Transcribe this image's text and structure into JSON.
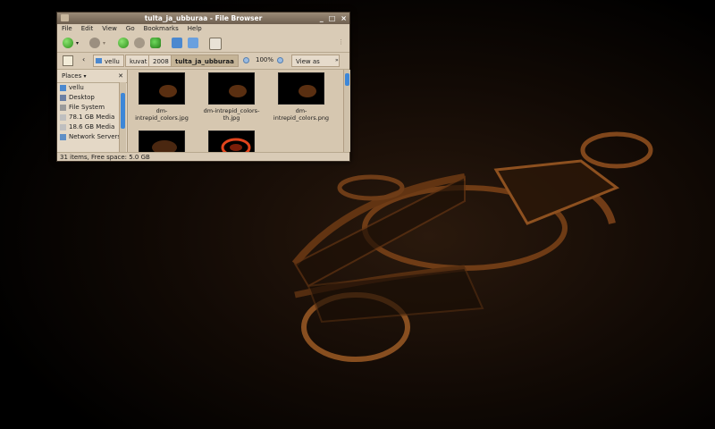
{
  "window": {
    "title": "tulta_ja_ubburaa - File Browser",
    "controls": {
      "minimize": "_",
      "maximize": "□",
      "close": "×"
    }
  },
  "menu": [
    "File",
    "Edit",
    "View",
    "Go",
    "Bookmarks",
    "Help"
  ],
  "toolbar": {
    "icons": [
      "back-icon",
      "forward-icon",
      "up-icon",
      "stop-icon",
      "reload-icon",
      "home-icon",
      "computer-icon",
      "search-icon"
    ]
  },
  "location": {
    "breadcrumbs": [
      "vellu",
      "kuvat",
      "2008",
      "tulta_ja_ubburaa"
    ],
    "zoom": "100%",
    "view_mode": "View as Icons"
  },
  "sidebar": {
    "header": "Places",
    "items": [
      "vellu",
      "Desktop",
      "File System",
      "78.1 GB Media",
      "18.6 GB Media",
      "Network Servers"
    ]
  },
  "files": [
    {
      "name": "dm-intrepid_colors.jpg"
    },
    {
      "name": "dm-intrepid_colors-th.jpg"
    },
    {
      "name": "dm-intrepid_colors.png"
    },
    {
      "name": ""
    },
    {
      "name": ""
    }
  ],
  "status": "31 items, Free space: 5.0 GB",
  "colors": {
    "accent": "#3d87d8",
    "window_bg": "#d9cbb6",
    "desktop_glow": "#b5621e"
  }
}
